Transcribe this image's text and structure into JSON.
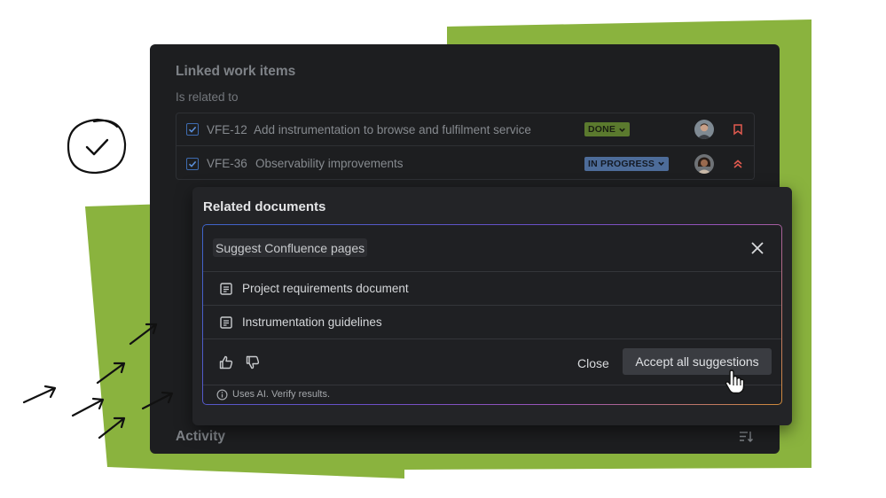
{
  "colors": {
    "green_accent": "#8ab33e",
    "panel_bg": "#1d1e20",
    "done_lozenge": "#5b7a2e",
    "in_progress_lozenge": "#4d6c99",
    "priority_red": "#e25a4f",
    "checkbox_blue": "#3e6bb0"
  },
  "linked_items": {
    "title": "Linked work items",
    "relation": "Is related to",
    "items": [
      {
        "key": "VFE-12",
        "summary": "Add instrumentation to browse and fulfilment service",
        "status": "DONE",
        "checked": true,
        "priority_icon": "priority-medium-icon"
      },
      {
        "key": "VFE-36",
        "summary": "Observability improvements",
        "status": "IN PROGRESS",
        "checked": true,
        "priority_icon": "priority-high-icon"
      }
    ]
  },
  "activity": {
    "title": "Activity",
    "icon": "sort-icon"
  },
  "related_docs": {
    "title": "Related documents",
    "suggest_label": "Suggest Confluence pages",
    "documents": [
      {
        "label": "Project requirements document",
        "icon": "page-icon"
      },
      {
        "label": "Instrumentation guidelines",
        "icon": "page-icon"
      }
    ],
    "close_label": "Close",
    "accept_label": "Accept all suggestions",
    "ai_note": "Uses AI. Verify results."
  }
}
